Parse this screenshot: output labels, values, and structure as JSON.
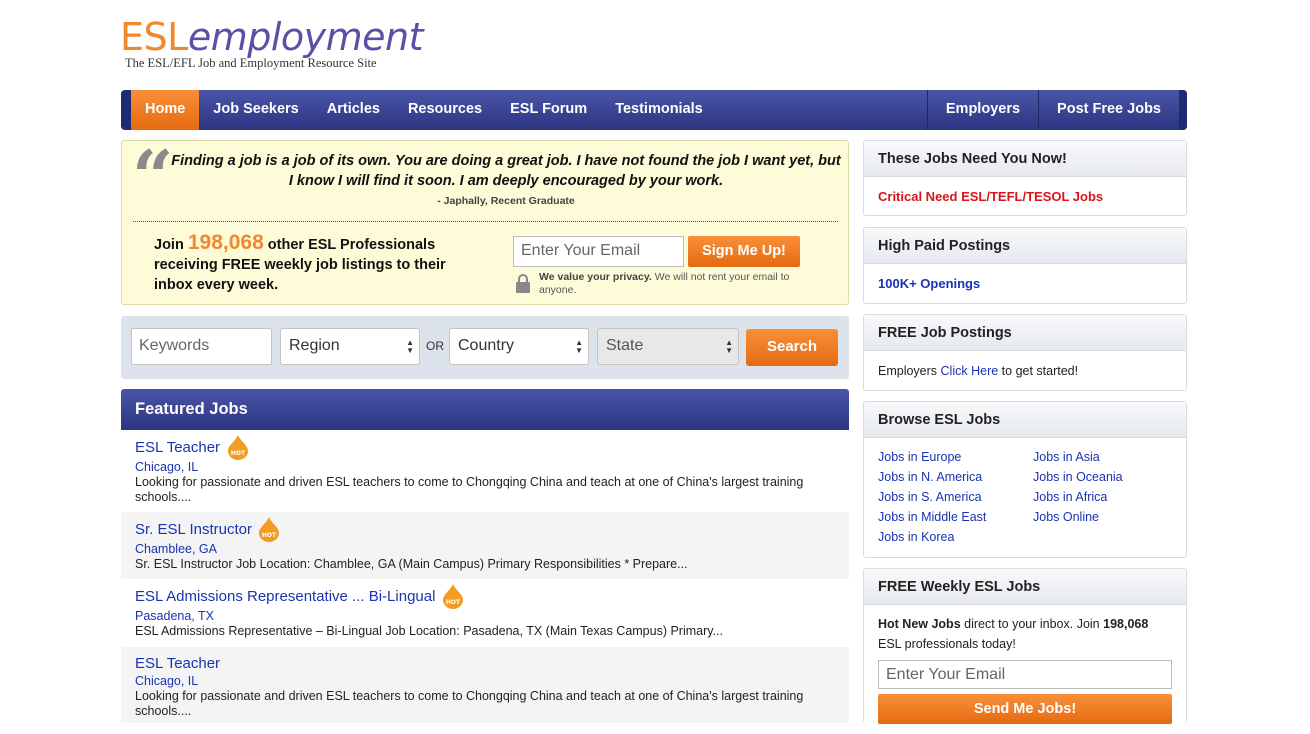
{
  "logo": {
    "esl": "ESL",
    "employment": "employment",
    "tagline": "The ESL/EFL Job and Employment Resource Site"
  },
  "nav": {
    "items": [
      "Home",
      "Job Seekers",
      "Articles",
      "Resources",
      "ESL Forum",
      "Testimonials"
    ],
    "active": "Home",
    "right_items": [
      "Employers",
      "Post Free Jobs"
    ]
  },
  "testimonial": {
    "quote": "Finding a job is a job of its own. You are doing a great job. I have not found the job I want yet, but I know I will find it soon. I am deeply encouraged by your work.",
    "author": "- Japhally, Recent Graduate"
  },
  "signup": {
    "join_prefix": "Join",
    "count": "198,068",
    "join_suffix": "other ESL Professionals receiving FREE weekly job listings to their inbox every week.",
    "email_placeholder": "Enter Your Email",
    "button": "Sign Me Up!",
    "privacy_bold": "We value your privacy.",
    "privacy_rest": "We will not rent your email to anyone."
  },
  "search": {
    "keywords_placeholder": "Keywords",
    "region": "Region",
    "or": "OR",
    "country": "Country",
    "state": "State",
    "button": "Search"
  },
  "featured": {
    "title": "Featured Jobs",
    "hot_badge": "HOT",
    "jobs": [
      {
        "title": "ESL Teacher",
        "hot": true,
        "location": "Chicago, IL",
        "desc": "Looking for passionate and driven ESL teachers to come to Chongqing China and teach at one of China's largest training schools...."
      },
      {
        "title": "Sr. ESL Instructor",
        "hot": true,
        "location": "Chamblee, GA",
        "desc": "Sr. ESL Instructor Job Location: Chamblee, GA (Main Campus) Primary Responsibilities * Prepare..."
      },
      {
        "title": "ESL Admissions Representative ... Bi-Lingual",
        "hot": true,
        "location": "Pasadena, TX",
        "desc": "ESL Admissions Representative – Bi-Lingual Job Location: Pasadena, TX (Main Texas Campus) Primary..."
      },
      {
        "title": "ESL Teacher",
        "hot": false,
        "location": "Chicago, IL",
        "desc": "Looking for passionate and driven ESL teachers to come to Chongqing China and teach at one of China's largest training schools...."
      }
    ]
  },
  "sidebar": {
    "need": {
      "title": "These Jobs Need You Now!",
      "link": "Critical Need ESL/TEFL/TESOL Jobs"
    },
    "high_paid": {
      "title": "High Paid Postings",
      "link": "100K+ Openings"
    },
    "free_postings": {
      "title": "FREE Job Postings",
      "prefix": "Employers",
      "link": "Click Here",
      "suffix": "to get started!"
    },
    "browse": {
      "title": "Browse ESL Jobs",
      "links": [
        "Jobs in Europe",
        "Jobs in Asia",
        "Jobs in N. America",
        "Jobs in Oceania",
        "Jobs in S. America",
        "Jobs in Africa",
        "Jobs in Middle East",
        "Jobs Online",
        "Jobs in Korea"
      ]
    },
    "weekly": {
      "title": "FREE Weekly ESL Jobs",
      "bold1": "Hot New Jobs",
      "text1": "direct to your inbox. Join",
      "count": "198,068",
      "text2": "ESL professionals today!",
      "email_placeholder": "Enter Your Email",
      "button": "Send Me Jobs!"
    }
  },
  "colors": {
    "accent_orange": "#f0882e",
    "nav_blue": "#2c3581",
    "link_blue": "#1a33b0",
    "alert_red": "#d9141c"
  }
}
